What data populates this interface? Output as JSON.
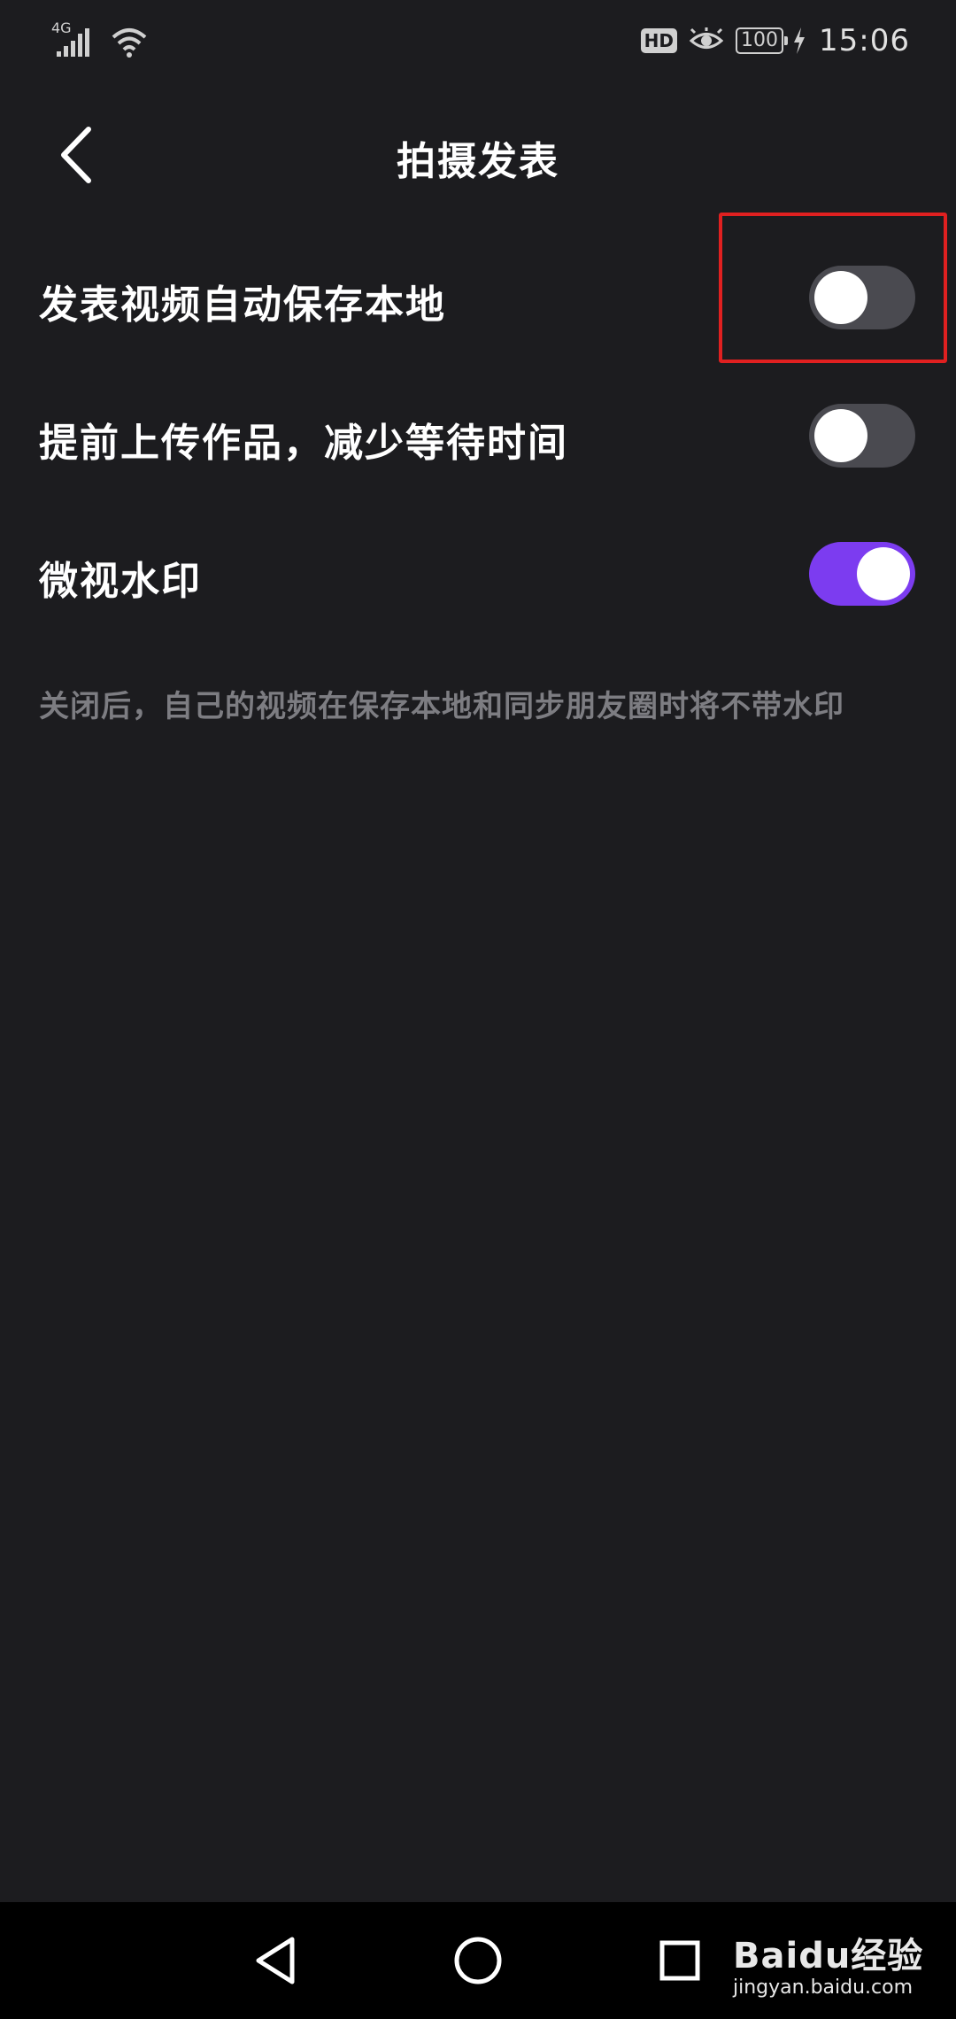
{
  "status_bar": {
    "network": "4G",
    "hd": "HD",
    "battery": "100",
    "time": "15:06",
    "icons": [
      "signal-icon",
      "wifi-icon",
      "eye-icon",
      "charging-icon"
    ]
  },
  "header": {
    "title": "拍摄发表",
    "back_icon": "chevron-left-icon"
  },
  "settings": [
    {
      "label": "发表视频自动保存本地",
      "enabled": false
    },
    {
      "label": "提前上传作品，减少等待时间",
      "enabled": false
    },
    {
      "label": "微视水印",
      "enabled": true
    }
  ],
  "hint": "关闭后，自己的视频在保存本地和同步朋友圈时将不带水印",
  "highlight_color": "#e02020",
  "accent_color": "#7c3cf0",
  "nav_bar": {
    "icons": [
      "back-triangle-icon",
      "home-circle-icon",
      "recents-square-icon"
    ]
  },
  "watermark": {
    "logo": "Baidu经验",
    "url": "jingyan.baidu.com"
  }
}
